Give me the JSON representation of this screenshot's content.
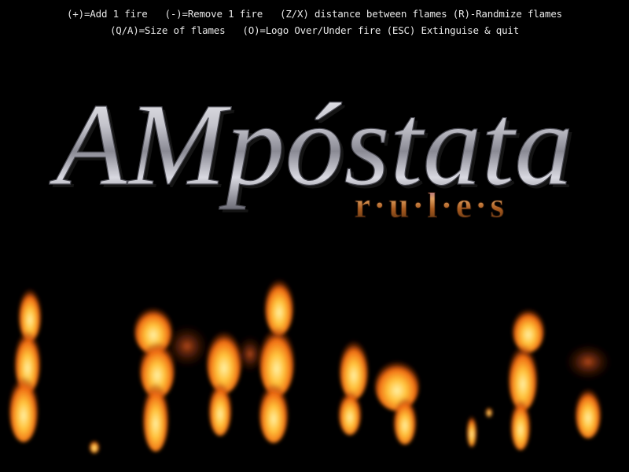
{
  "help": {
    "line1": "(+)=Add 1 fire   (-)=Remove 1 fire   (Z/X) distance between flames (R)-Randmize flames",
    "line2": "(Q/A)=Size of flames   (O)=Logo Over/Under fire (ESC) Extinguise & quit"
  },
  "logo": {
    "title": "AMpóstata",
    "subtitle": "r·u·l·e·s"
  },
  "fires": {
    "columns": [
      {
        "name": "fire-column-1",
        "intensity": "medium"
      },
      {
        "name": "fire-column-2",
        "intensity": "high"
      },
      {
        "name": "fire-column-3",
        "intensity": "high"
      },
      {
        "name": "fire-column-4",
        "intensity": "high"
      },
      {
        "name": "fire-column-5",
        "intensity": "high"
      },
      {
        "name": "fire-column-6",
        "intensity": "low"
      },
      {
        "name": "fire-column-7",
        "intensity": "high"
      },
      {
        "name": "fire-column-8",
        "intensity": "medium"
      }
    ]
  },
  "colors": {
    "background": "#000000",
    "help_text": "#e8e8e8",
    "logo_silver": "#c8c8d0",
    "subtitle_copper": "#b86a2a",
    "flame_core": "#ffe680",
    "flame_mid": "#ff9a1a",
    "flame_edge": "#c0300a"
  }
}
